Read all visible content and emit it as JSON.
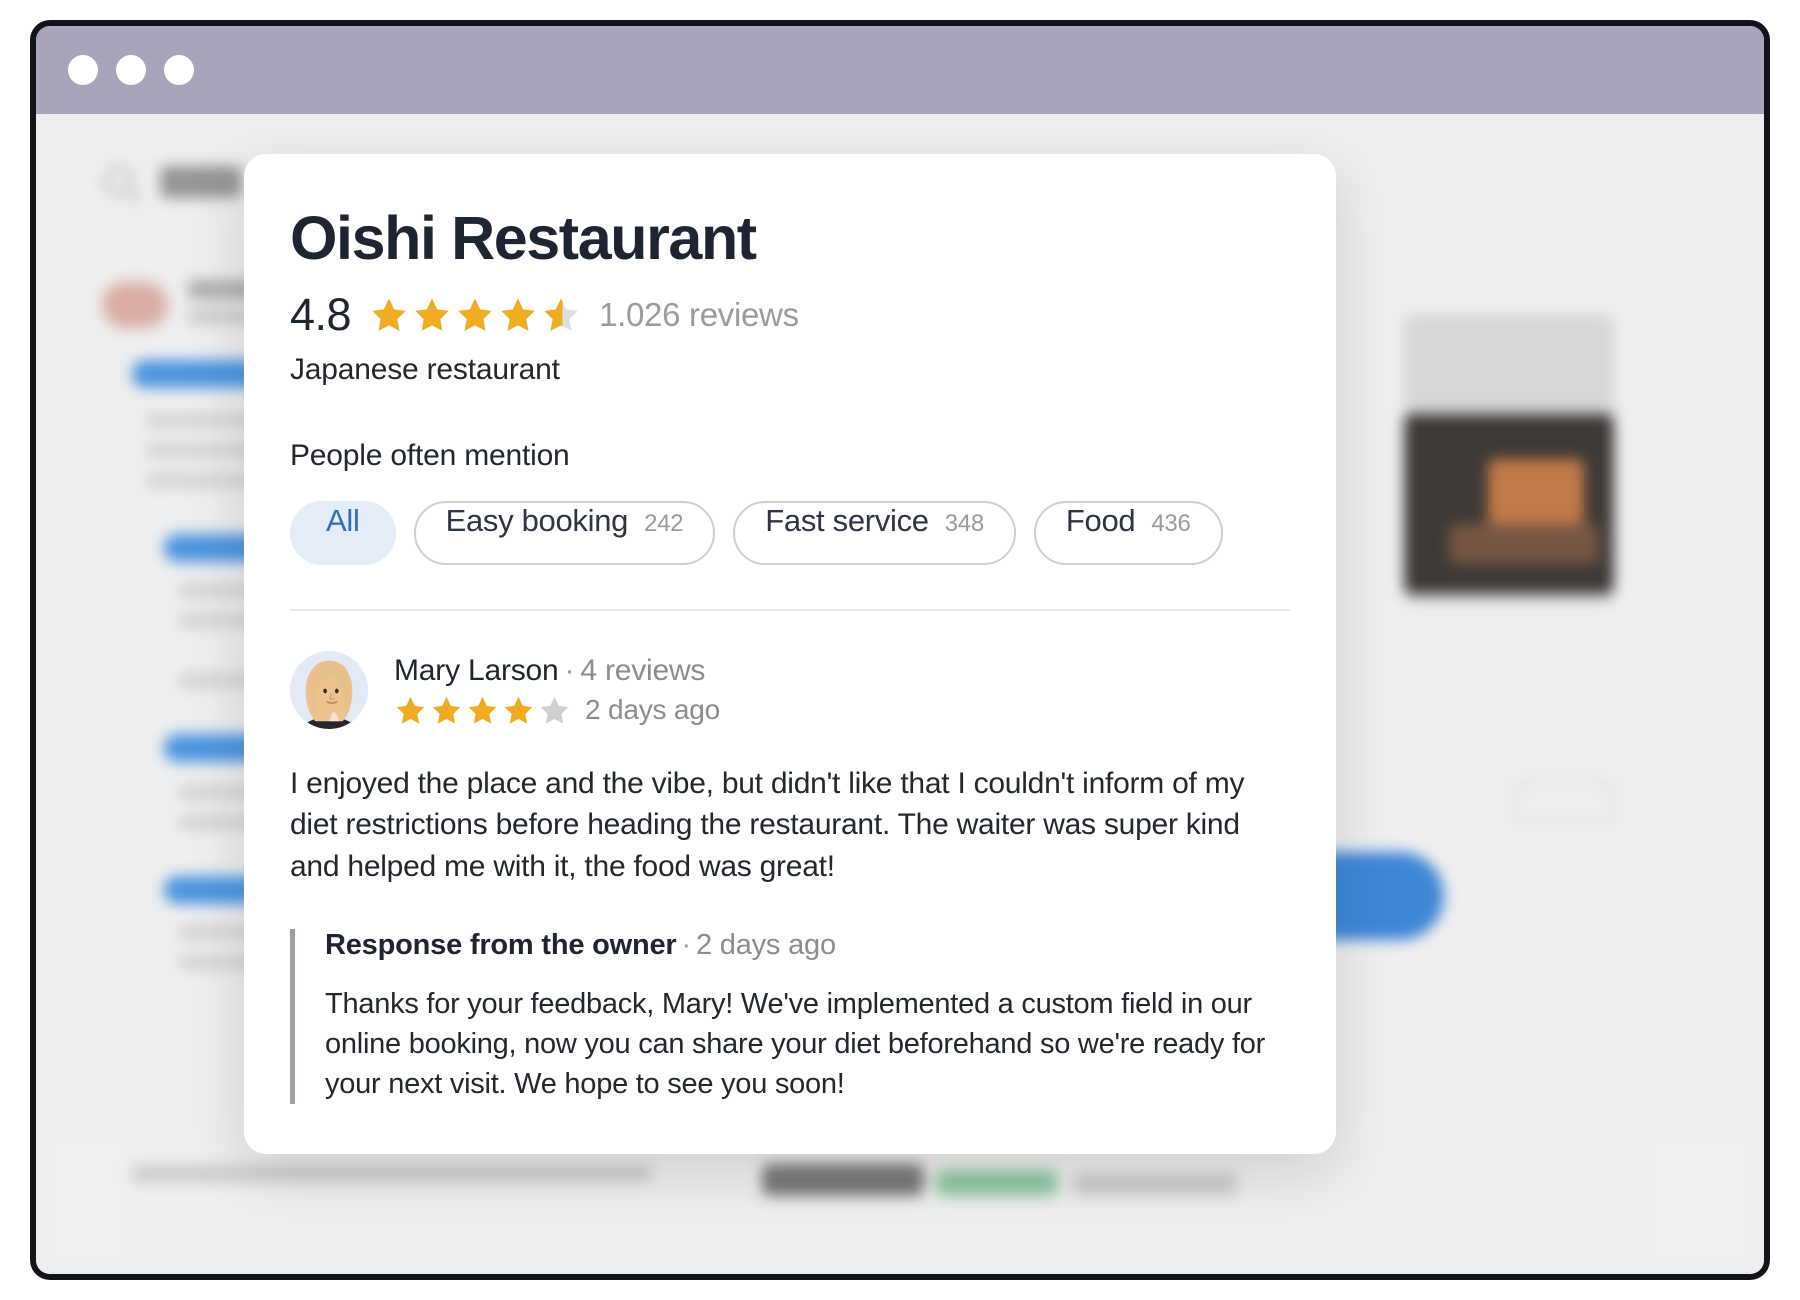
{
  "window": {
    "traffic_lights": [
      "close",
      "minimize",
      "maximize"
    ]
  },
  "modal": {
    "place_name": "Oishi Restaurant",
    "rating_value": "4.8",
    "rating_stars_filled": 4.5,
    "review_count_label": "1.026 reviews",
    "category": "Japanese restaurant",
    "mention_label": "People often mention",
    "chips": [
      {
        "label": "All",
        "count": "",
        "selected": true
      },
      {
        "label": "Easy booking",
        "count": "242",
        "selected": false
      },
      {
        "label": "Fast service",
        "count": "348",
        "selected": false
      },
      {
        "label": "Food",
        "count": "436",
        "selected": false
      }
    ],
    "review": {
      "reviewer_name": "Mary Larson",
      "separator": "·",
      "reviewer_reviews": "4 reviews",
      "stars_filled": 4,
      "stars_total": 5,
      "time_ago": "2 days ago",
      "text": "I enjoyed the place and the vibe, but didn't like that I couldn't inform of my diet restrictions before heading the restaurant. The waiter was super kind and helped me with it, the food was great!",
      "owner_response": {
        "title": "Response from the owner",
        "separator": "·",
        "time_ago": "2 days ago",
        "text": "Thanks for your feedback, Mary! We've implemented a custom field in our online booking, now you can share your diet beforehand so we're ready for your next visit. We hope to see you soon!"
      }
    }
  },
  "colors": {
    "star_gold": "#f0ab21",
    "star_empty": "#cfcfcf",
    "chip_selected_bg": "#e4ecf7",
    "chip_selected_text": "#2f6fba",
    "titlebar": "#a9a4bb",
    "accent_blue": "#2f7fd4"
  }
}
